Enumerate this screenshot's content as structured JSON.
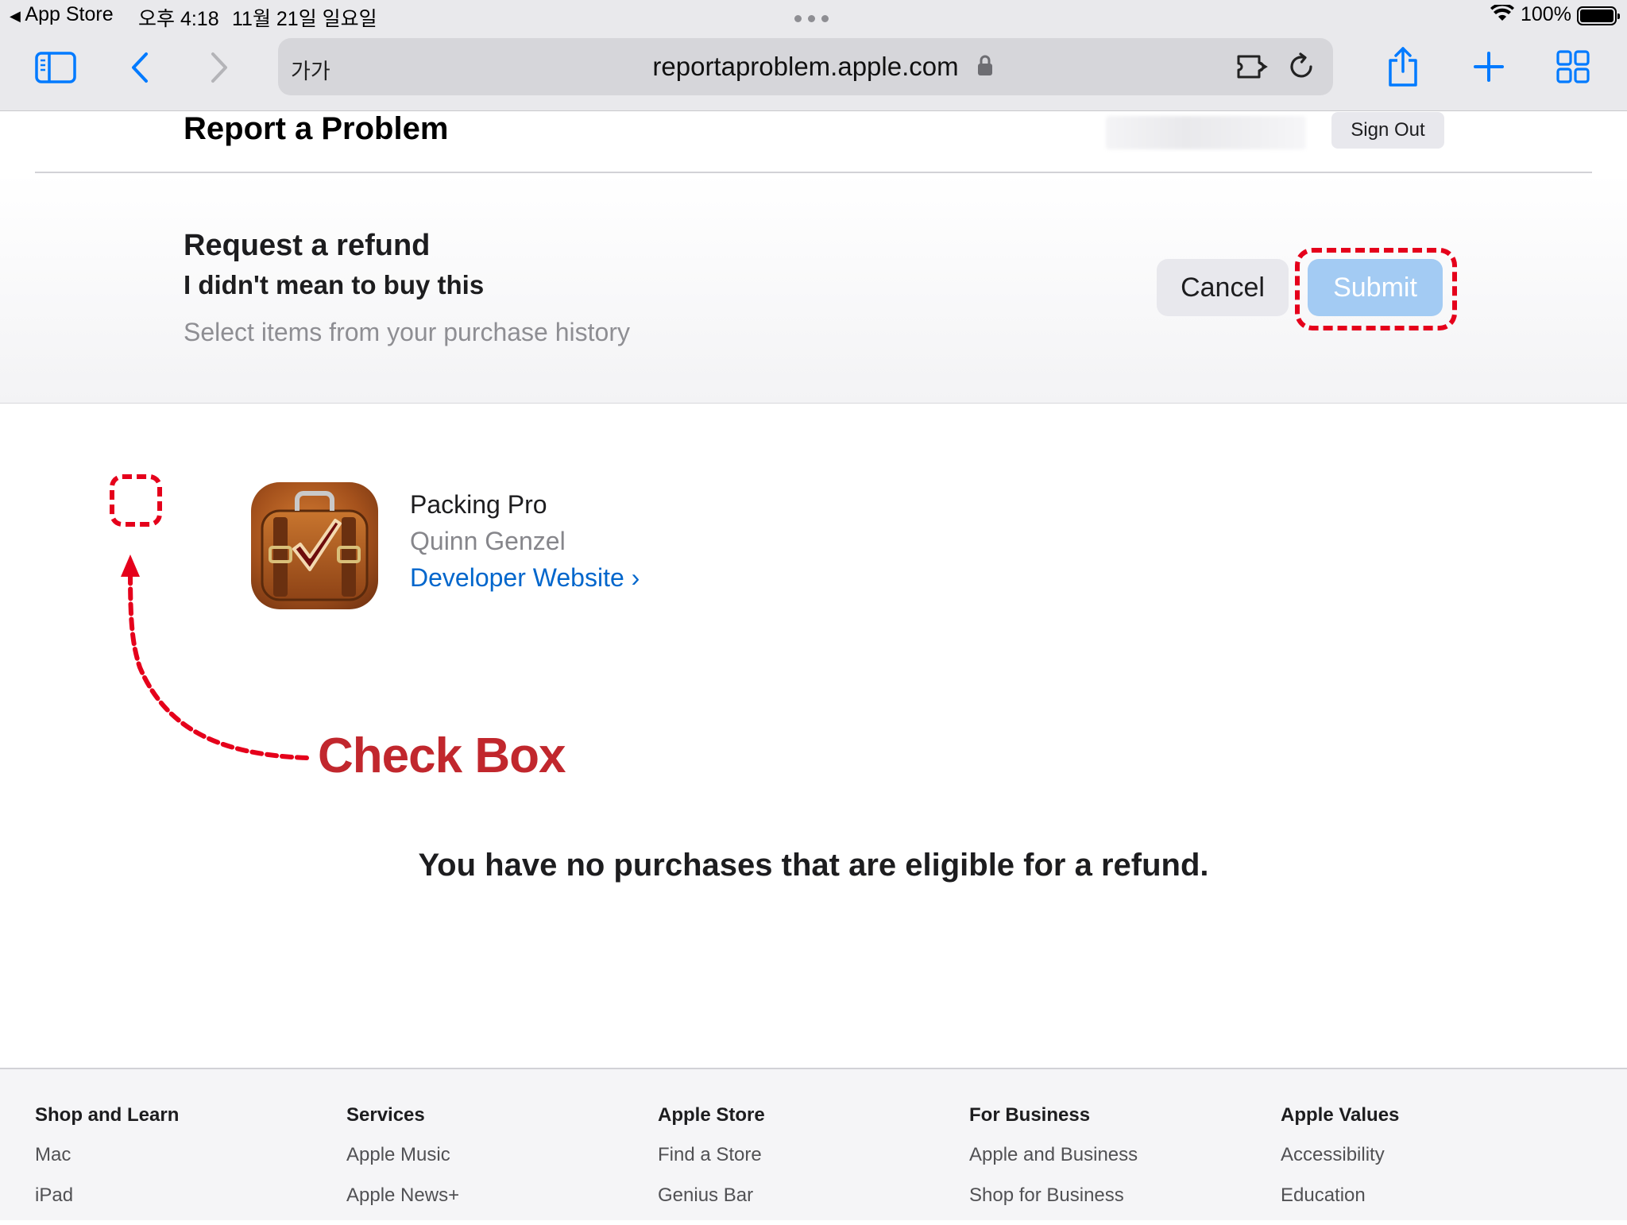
{
  "status_bar": {
    "back_app": "App Store",
    "time": "오후 4:18",
    "date": "11월 21일 일요일",
    "battery": "100%",
    "battery_level": 1.0
  },
  "browser": {
    "text_size_label": "가가",
    "url": "reportaproblem.apple.com"
  },
  "header": {
    "title": "Report a Problem",
    "sign_out": "Sign Out"
  },
  "refund": {
    "title": "Request a refund",
    "reason": "I didn't mean to buy this",
    "hint": "Select items from your purchase history",
    "cancel_label": "Cancel",
    "submit_label": "Submit"
  },
  "item": {
    "name": "Packing Pro",
    "developer": "Quinn Genzel",
    "link_label": "Developer Website ›"
  },
  "annotation": {
    "text": "Check Box",
    "color": "#c1272d",
    "mark_color": "#e5001b"
  },
  "message": "You have no purchases that are eligible for a refund.",
  "footer": {
    "columns": [
      {
        "heading": "Shop and Learn",
        "links": [
          "Mac",
          "iPad"
        ]
      },
      {
        "heading": "Services",
        "links": [
          "Apple Music",
          "Apple News+"
        ]
      },
      {
        "heading": "Apple Store",
        "links": [
          "Find a Store",
          "Genius Bar"
        ]
      },
      {
        "heading": "For Business",
        "links": [
          "Apple and Business",
          "Shop for Business"
        ]
      },
      {
        "heading": "Apple Values",
        "links": [
          "Accessibility",
          "Education"
        ]
      }
    ]
  },
  "colors": {
    "accent": "#007aff",
    "link": "#0066cc",
    "submit_disabled": "#a3cbf3"
  }
}
